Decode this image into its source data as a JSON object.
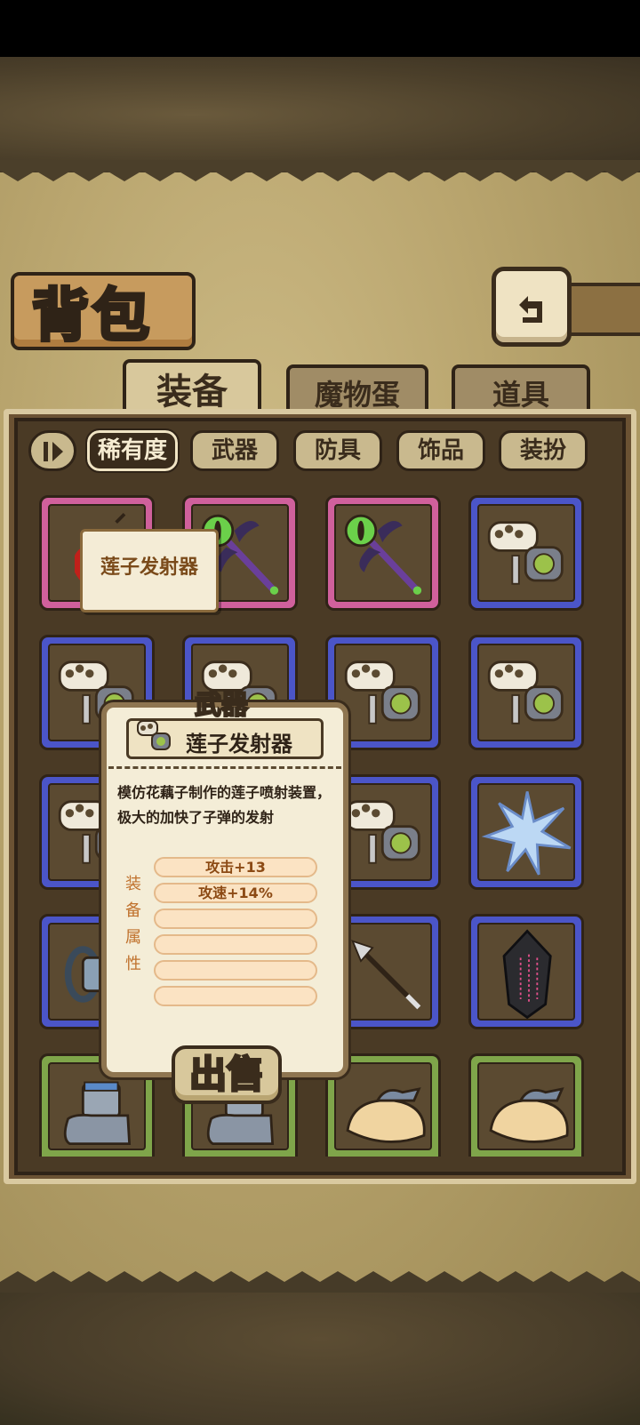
{
  "page": {
    "title": "背包"
  },
  "tabs": [
    {
      "label": "装备",
      "active": true
    },
    {
      "label": "魔物蛋",
      "active": false
    },
    {
      "label": "道具",
      "active": false
    }
  ],
  "filters": [
    {
      "label": "稀有度",
      "active": true
    },
    {
      "label": "武器",
      "active": false
    },
    {
      "label": "防具",
      "active": false
    },
    {
      "label": "饰品",
      "active": false
    },
    {
      "label": "装扮",
      "active": false
    }
  ],
  "slots": [
    {
      "rarity": "pink",
      "icon": "red-weapon-icon"
    },
    {
      "rarity": "pink",
      "icon": "eye-staff-icon"
    },
    {
      "rarity": "pink",
      "icon": "eye-staff-icon"
    },
    {
      "rarity": "blue",
      "icon": "lotus-launcher-icon"
    },
    {
      "rarity": "blue",
      "icon": "lotus-launcher-icon"
    },
    {
      "rarity": "blue",
      "icon": "lotus-launcher-icon"
    },
    {
      "rarity": "blue",
      "icon": "lotus-launcher-icon"
    },
    {
      "rarity": "blue",
      "icon": "lotus-launcher-icon"
    },
    {
      "rarity": "blue",
      "icon": "lotus-launcher-icon"
    },
    {
      "rarity": "blue",
      "icon": "lotus-launcher-icon"
    },
    {
      "rarity": "blue",
      "icon": "lotus-launcher-icon"
    },
    {
      "rarity": "blue",
      "icon": "ice-crystal-icon"
    },
    {
      "rarity": "blue",
      "icon": "bracelet-icon"
    },
    {
      "rarity": "blue",
      "icon": "unknown-icon"
    },
    {
      "rarity": "blue",
      "icon": "spear-icon"
    },
    {
      "rarity": "blue",
      "icon": "dark-crystal-icon"
    },
    {
      "rarity": "green",
      "icon": "boots-icon"
    },
    {
      "rarity": "green",
      "icon": "boots-icon"
    },
    {
      "rarity": "green",
      "icon": "fish-pie-icon"
    },
    {
      "rarity": "green",
      "icon": "fish-pie-icon"
    }
  ],
  "hover_tooltip": {
    "label": "莲子发射器"
  },
  "detail": {
    "category": "武器",
    "name": "莲子发射器",
    "description": "模仿花藕子制作的莲子喷射装置，极大的加快了子弹的发射",
    "attr_label_chars": [
      "装",
      "备",
      "属",
      "性"
    ],
    "attributes": [
      "攻击+13",
      "攻速+14%",
      "",
      "",
      "",
      ""
    ],
    "sell_label": "出售"
  },
  "colors": {
    "pink": "#d0609c",
    "blue": "#4b55c8",
    "green": "#7fa54a"
  }
}
